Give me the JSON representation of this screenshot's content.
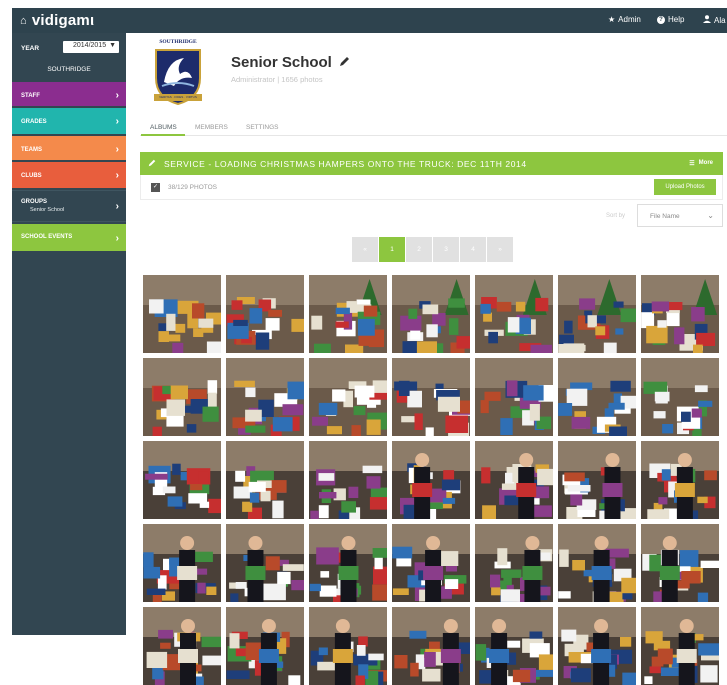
{
  "topbar": {
    "logo": "vidigamι",
    "admin_label": "Admin",
    "help_label": "Help",
    "user_label": "Ala"
  },
  "sidebar": {
    "year_label": "YEAR",
    "year_value": "2014/2015",
    "school": "SOUTHRIDGE",
    "items": [
      {
        "label": "STAFF",
        "color": "#8b2d8f"
      },
      {
        "label": "GRADES",
        "color": "#21b5ad"
      },
      {
        "label": "TEAMS",
        "color": "#f48a4b"
      },
      {
        "label": "CLUBS",
        "color": "#e85e3d"
      },
      {
        "label": "GROUPS",
        "sub": "Senior School",
        "color": "#324651"
      },
      {
        "label": "SCHOOL EVENTS",
        "color": "#8dc63f"
      }
    ]
  },
  "header": {
    "crest_text": "SOUTHRIDGE",
    "crest_motto": "VERITAS · FIDES · VIRTUS",
    "title": "Senior School",
    "subtitle": "Administrator | 1656 photos"
  },
  "tabs": [
    "ALBUMS",
    "MEMBERS",
    "SETTINGS"
  ],
  "album": {
    "title": "SERVICE - LOADING CHRISTMAS HAMPERS ONTO THE TRUCK: DEC 11TH 2014",
    "more_label": "More",
    "photo_count": "38/129 PHOTOS",
    "upload_label": "Upload Photos"
  },
  "sort": {
    "label": "Sort by",
    "value": "File Name"
  },
  "pager": [
    "«",
    "1",
    "2",
    "3",
    "4",
    "»"
  ],
  "colors": {
    "accent": "#8dc63f",
    "topbar": "#2e434e",
    "sidebar": "#324651"
  }
}
